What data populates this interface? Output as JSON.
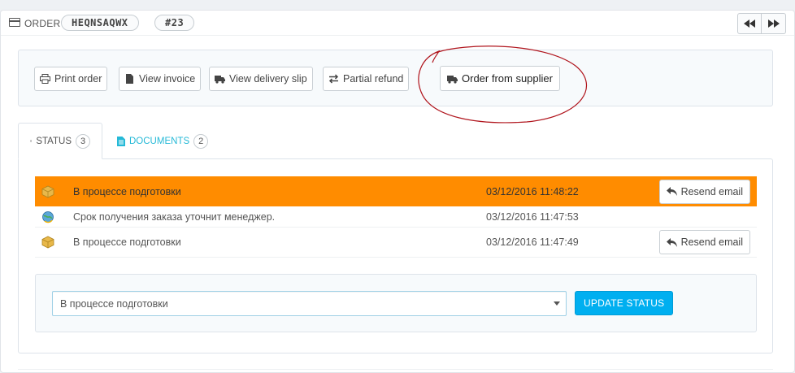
{
  "header": {
    "order_label": "ORDER",
    "reference": "HEQNSAQWX",
    "number": "#23",
    "prev_icon": "fast-backward-icon",
    "next_icon": "fast-forward-icon"
  },
  "actions": {
    "print_order": "Print order",
    "view_invoice": "View invoice",
    "view_delivery_slip": "View delivery slip",
    "partial_refund": "Partial refund",
    "order_from_supplier": "Order from supplier"
  },
  "tabs": {
    "status_label": "STATUS",
    "status_count": "3",
    "documents_label": "DOCUMENTS",
    "documents_count": "2"
  },
  "history": {
    "rows": [
      {
        "status": "В процессе подготовки",
        "date": "03/12/2016 11:48:22",
        "resend": "Resend email",
        "icon": "package-icon"
      },
      {
        "status": "Срок получения заказа уточнит менеджер.",
        "date": "03/12/2016 11:47:53",
        "icon": "refresh-globe-icon"
      },
      {
        "status": "В процессе подготовки",
        "date": "03/12/2016 11:47:49",
        "resend": "Resend email",
        "icon": "package-icon"
      }
    ]
  },
  "update": {
    "selected_status": "В процессе подготовки",
    "button_label": "UPDATE STATUS"
  },
  "colors": {
    "accent": "#00aff0",
    "highlight_row": "#ff8c00",
    "annotation": "#b0141c"
  }
}
